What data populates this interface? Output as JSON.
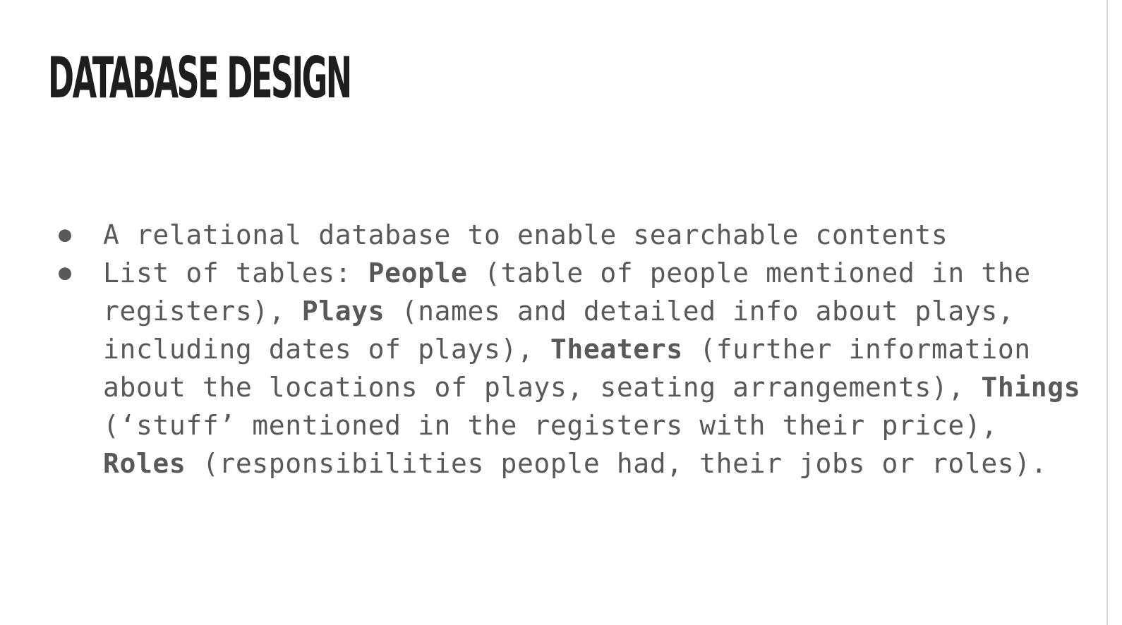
{
  "slide": {
    "title": "DATABASE DESIGN",
    "bullets": [
      {
        "text": "A relational database to enable searchable contents"
      },
      {
        "intro": "List of tables: ",
        "tables": [
          {
            "name": "People",
            "desc": " (table of people mentioned in the registers), "
          },
          {
            "name": "Plays",
            "desc": " (names and detailed info about plays, including dates of plays), "
          },
          {
            "name": "Theaters",
            "desc": " (further information about the locations of plays, seating arrangements), "
          },
          {
            "name": "Things",
            "desc": " (‘stuff’ mentioned in the registers with their price), "
          },
          {
            "name": "Roles",
            "desc": " (responsibilities people had, their jobs or roles)."
          }
        ]
      }
    ],
    "bullet_glyph": "●"
  }
}
